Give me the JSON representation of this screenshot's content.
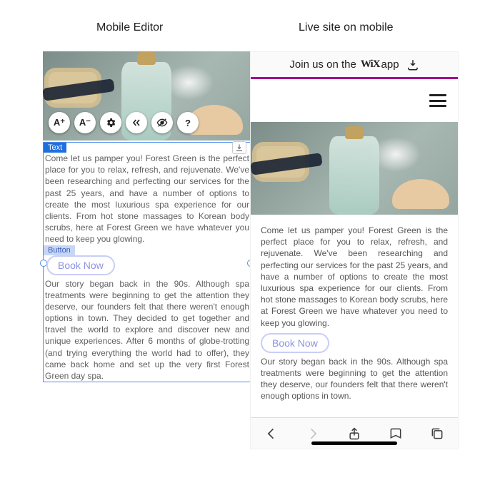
{
  "labels": {
    "left": "Mobile Editor",
    "right": "Live site on mobile"
  },
  "banner": {
    "prefix": "Join us on the ",
    "brand": "WiX",
    "suffix": "app"
  },
  "editor": {
    "toolbar": [
      {
        "name": "increase-font-icon",
        "glyph": "A⁺"
      },
      {
        "name": "decrease-font-icon",
        "glyph": "A⁻"
      },
      {
        "name": "gear-icon"
      },
      {
        "name": "resize-icon"
      },
      {
        "name": "eye-off-icon"
      },
      {
        "name": "help-icon",
        "glyph": "?"
      }
    ],
    "selection_label_text": "Text",
    "selection_label_button": "Button"
  },
  "content": {
    "paragraph1": "Come let us pamper you! Forest Green is the perfect place for you to relax, refresh, and rejuvenate. We've been researching and perfecting our services for the past 25 years, and have a number of options to create the most luxurious spa experience for our clients. From hot stone massages to Korean body scrubs, here at Forest Green we have whatever you need to keep you glowing.",
    "book_label": "Book Now",
    "paragraph2_full": "Our story began back in the 90s. Although spa treatments were beginning to get the attention they deserve, our founders felt that there weren't enough options in town. They decided to get together and travel the world to explore and discover new and unique experiences. After 6 months of globe-trotting (and trying everything the world had to offer), they came back home and set up the very first Forest Green day spa.",
    "paragraph2_short": "Our story began back in the 90s. Although spa treatments were beginning to get the attention they deserve, our founders felt that there weren't enough options in town."
  },
  "icons": {
    "hamburger": "hamburger-icon",
    "download": "download-icon",
    "back": "back-icon",
    "forward": "forward-icon",
    "share": "share-icon",
    "bookmarks": "bookmarks-icon",
    "tabs": "tabs-icon"
  }
}
